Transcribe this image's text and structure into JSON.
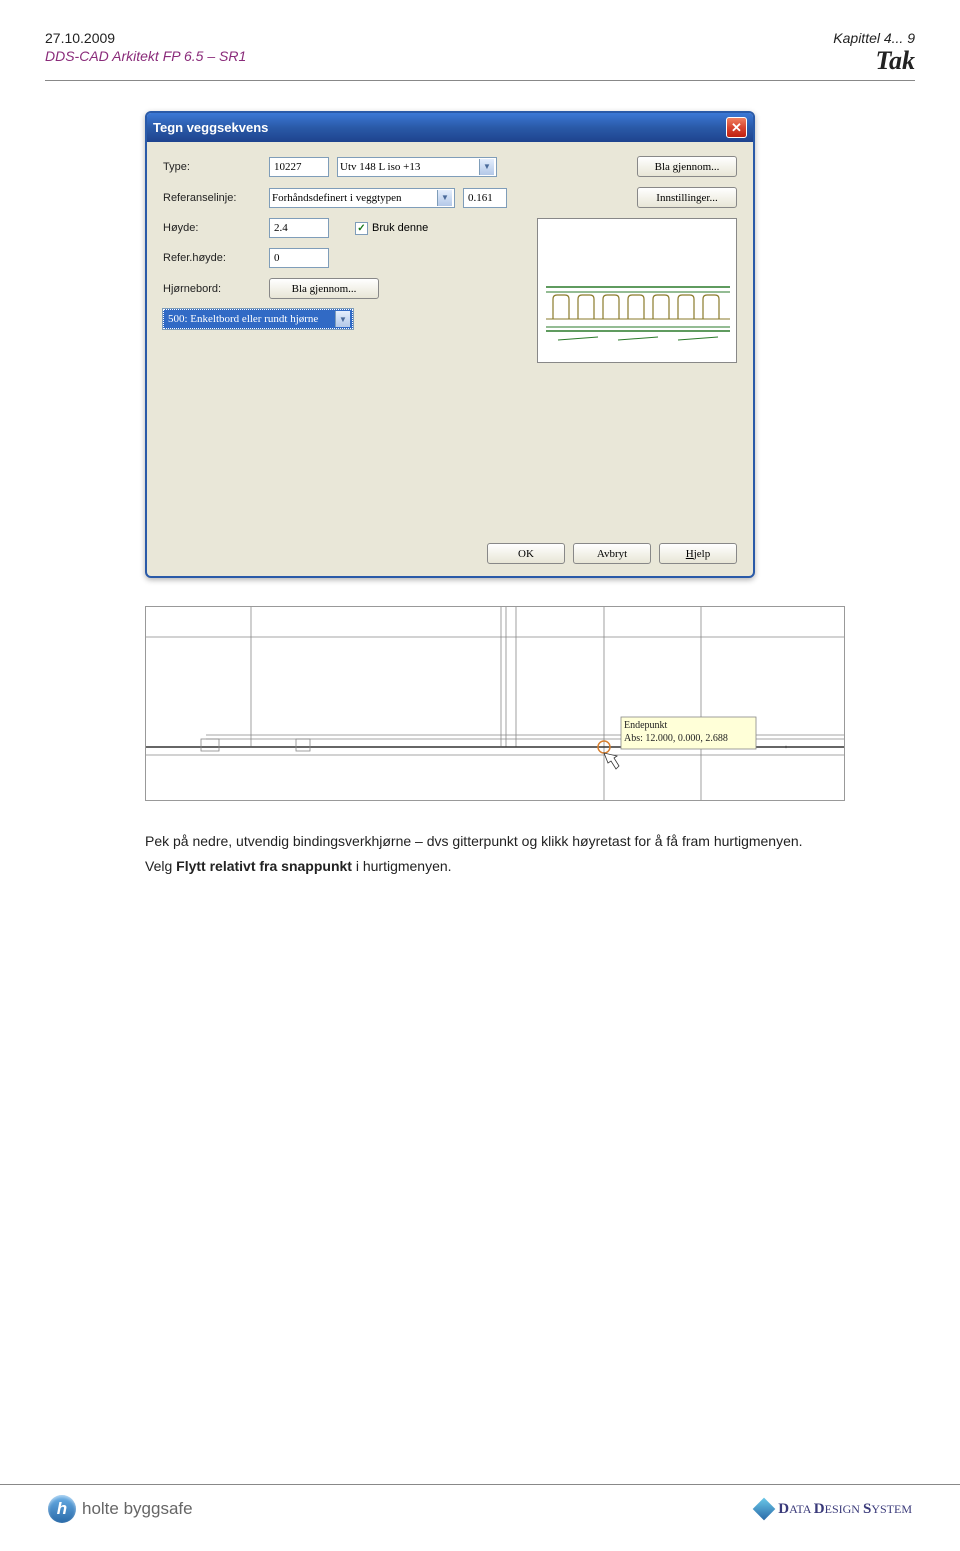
{
  "header": {
    "date": "27.10.2009",
    "software": "DDS-CAD Arkitekt  FP  6.5 – SR1",
    "chapter": "Kapittel 4...  9",
    "section_title": "Tak"
  },
  "dialog": {
    "title": "Tegn veggsekvens",
    "labels": {
      "type": "Type:",
      "refline": "Referanselinje:",
      "height": "Høyde:",
      "refheight": "Refer.høyde:",
      "corner": "Hjørnebord:"
    },
    "type_code": "10227",
    "type_desc": "Utv 148 L iso +13",
    "refline_value": "Forhåndsdefinert i veggtypen",
    "refline_num": "0.161",
    "height_value": "2.4",
    "refheight_value": "0",
    "use_this": "Bruk denne",
    "corner_select": "500: Enkeltbord eller rundt hjørne",
    "buttons": {
      "browse": "Bla gjennom...",
      "settings": "Innstillinger...",
      "ok": "OK",
      "cancel": "Avbryt",
      "help_h": "H",
      "help_rest": "jelp"
    }
  },
  "drawing_tooltip": {
    "line1": "Endepunkt",
    "line2": "Abs: 12.000, 0.000, 2.688"
  },
  "body": {
    "p1_pre": "Pek på nedre, utvendig bindingsverkhjørne – dvs gitterpunkt og klikk høyretast for å få fram hurtigmenyen.",
    "p2_pre": "Velg ",
    "p2_bold": "Flytt relativt fra snappunkt",
    "p2_post": " i hurtigmenyen."
  },
  "footer": {
    "holte": "holte byggsafe",
    "dds_1": "D",
    "dds_2": "ATA ",
    "dds_3": "D",
    "dds_4": "ESIGN ",
    "dds_5": "S",
    "dds_6": "YSTEM"
  }
}
